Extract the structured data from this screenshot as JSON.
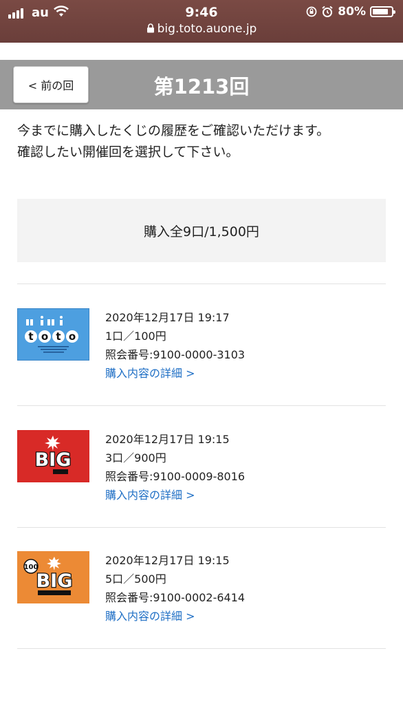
{
  "status": {
    "carrier": "au",
    "time": "9:46",
    "battery": "80%",
    "url": "big.toto.auone.jp"
  },
  "header": {
    "back_label": "<  前の回",
    "title": "第1213回"
  },
  "intro": {
    "line1": "今までに購入したくじの履歴をご確認いただけます。",
    "line2": "確認したい開催回を選択して下さい。"
  },
  "summary": "購入全9口/1,500円",
  "purchases": [
    {
      "logo": "mini-toto-logo",
      "datetime": "2020年12月17日 19:17",
      "quantity": "1口／100円",
      "reference": "照会番号:9100-0000-3103",
      "link": "購入内容の詳細  >"
    },
    {
      "logo": "big-logo",
      "datetime": "2020年12月17日 19:15",
      "quantity": "3口／900円",
      "reference": "照会番号:9100-0009-8016",
      "link": "購入内容の詳細  >"
    },
    {
      "logo": "100yen-big-logo",
      "datetime": "2020年12月17日 19:15",
      "quantity": "5口／500円",
      "reference": "照会番号:9100-0002-6414",
      "link": "購入内容の詳細  >"
    }
  ],
  "colors": {
    "header_bg": "#9a9a9a",
    "link": "#1f6fc5",
    "status_bg": "#6a3e3a"
  }
}
